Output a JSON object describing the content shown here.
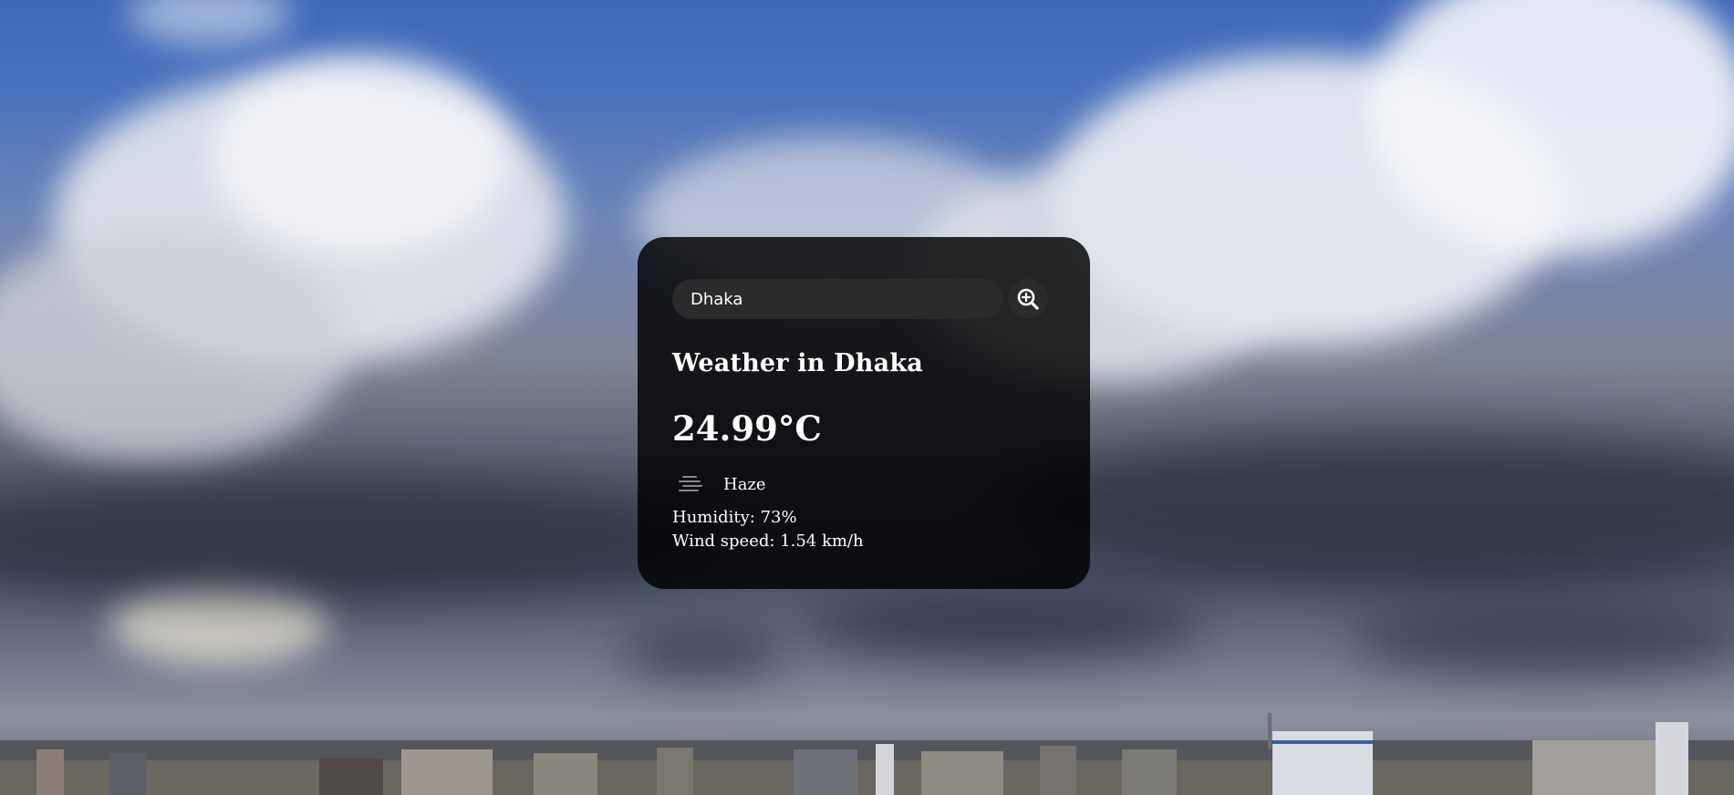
{
  "search": {
    "value": "Dhaka",
    "button_icon": "search-icon"
  },
  "weather": {
    "city_title": "Weather in Dhaka",
    "temperature": "24.99°C",
    "condition_icon": "haze-icon",
    "description": "Haze",
    "humidity": "Humidity: 73%",
    "wind": "Wind speed: 1.54 km/h"
  },
  "colors": {
    "card_background": "#000000",
    "input_background": "#2b2b2b",
    "text": "#ffffff"
  }
}
